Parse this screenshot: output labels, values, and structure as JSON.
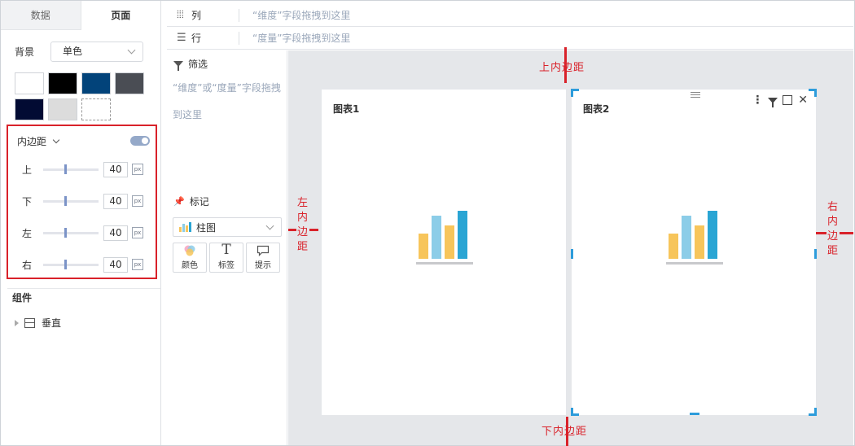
{
  "tabs": [
    {
      "label": "数据"
    },
    {
      "label": "页面"
    }
  ],
  "background": {
    "label": "背景",
    "value": "单色",
    "swatches": [
      "#ffffff",
      "#000000",
      "#02437a",
      "#4a4d54",
      "#020b33",
      "#dcdcdc",
      "#ffffff"
    ]
  },
  "padding": {
    "title": "内边距",
    "toggle_on": true,
    "rows": [
      {
        "label": "上",
        "value": "40",
        "unit": "px"
      },
      {
        "label": "下",
        "value": "40",
        "unit": "px"
      },
      {
        "label": "左",
        "value": "40",
        "unit": "px"
      },
      {
        "label": "右",
        "value": "40",
        "unit": "px"
      }
    ]
  },
  "components": {
    "title": "组件",
    "item": "垂直"
  },
  "shelves": {
    "columns": {
      "label": "列",
      "hint": "“维度”字段拖拽到这里"
    },
    "rows": {
      "label": "行",
      "hint": "“度量”字段拖拽到这里"
    }
  },
  "filter": {
    "title": "筛选",
    "hint": "“维度”或“度量”字段拖拽到这里"
  },
  "marks": {
    "title": "标记",
    "type": "柱图",
    "buttons": [
      {
        "label": "颜色"
      },
      {
        "label": "标签"
      },
      {
        "label": "提示"
      }
    ]
  },
  "cards": [
    {
      "title": "图表1"
    },
    {
      "title": "图表2"
    }
  ],
  "annotations": {
    "top": "上内边距",
    "bottom": "下内边距",
    "left": "左内边距",
    "right": "右内边距"
  },
  "colors": {
    "annotation": "#d9222a",
    "selection": "#2d9cdb",
    "bar_yellow": "#f7c55b",
    "bar_lightblue": "#8ccde8",
    "bar_blue": "#2aa5d4"
  }
}
